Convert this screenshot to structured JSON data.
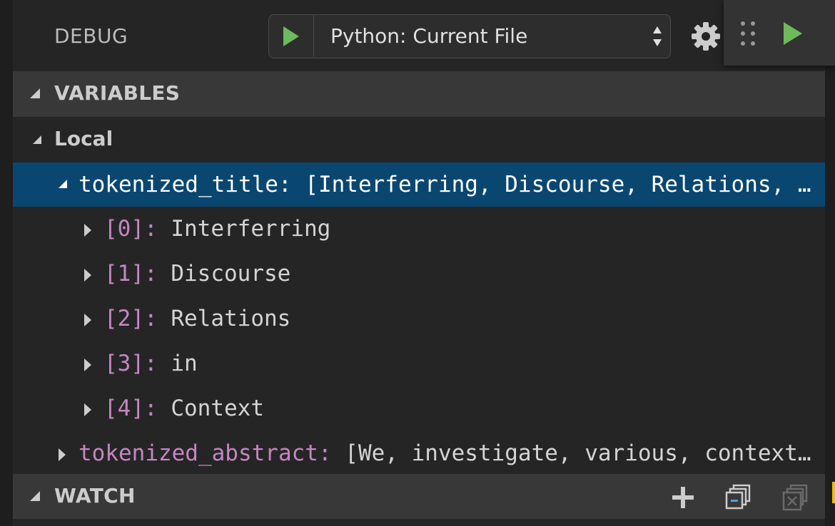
{
  "header": {
    "title": "DEBUG",
    "configuration": "Python: Current File"
  },
  "sections": {
    "variables": "VARIABLES",
    "watch": "WATCH"
  },
  "scope": {
    "label": "Local"
  },
  "variables": {
    "tokenized_title": {
      "name": "tokenized_title",
      "separator": ":",
      "value": "[Interferring, Discourse, Relations, …"
    },
    "items": [
      {
        "index": "[0]",
        "separator": ":",
        "value": "Interferring"
      },
      {
        "index": "[1]",
        "separator": ":",
        "value": "Discourse"
      },
      {
        "index": "[2]",
        "separator": ":",
        "value": "Relations"
      },
      {
        "index": "[3]",
        "separator": ":",
        "value": "in"
      },
      {
        "index": "[4]",
        "separator": ":",
        "value": "Context"
      }
    ],
    "tokenized_abstract": {
      "name": "tokenized_abstract",
      "separator": ":",
      "value": "[We, investigate, various, context…"
    }
  },
  "colors": {
    "accent_green": "#6dba5c",
    "selection": "#094771",
    "variable_name": "#c586c0",
    "section_header_bg": "#383838"
  },
  "icons": {
    "start": "play-icon",
    "settings": "gear-icon",
    "drag": "grip-icon",
    "continue": "continue-icon",
    "add": "plus-icon",
    "collapse": "collapse-all-icon",
    "remove": "remove-all-icon"
  }
}
